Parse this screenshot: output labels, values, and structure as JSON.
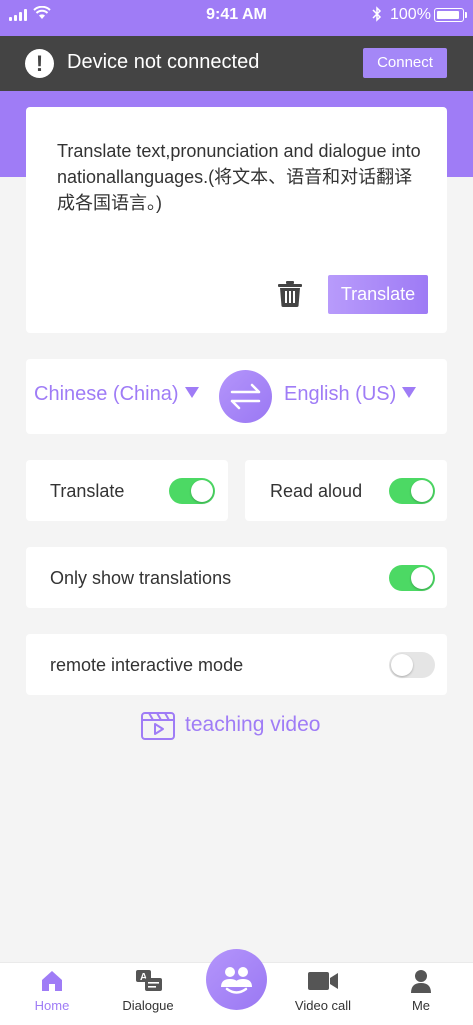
{
  "status_bar": {
    "time": "9:41 AM",
    "battery": "100%"
  },
  "alert": {
    "message": "Device not connected",
    "connect_label": "Connect",
    "icon": "exclamation-icon"
  },
  "input": {
    "text": "Translate text,pronunciation and dialogue into nationallanguages.(将文本、语音和对话翻译成各国语言。)",
    "translate_label": "Translate",
    "icon": "trash-icon"
  },
  "languages": {
    "source": "Chinese (China)",
    "target": "English (US)",
    "swap_icon": "swap-arrows-icon"
  },
  "toggles": {
    "translate": {
      "label": "Translate",
      "on": true
    },
    "read_aloud": {
      "label": "Read aloud",
      "on": true
    },
    "only_show": {
      "label": "Only show translations",
      "on": true
    },
    "remote": {
      "label": "remote interactive mode",
      "on": false
    }
  },
  "teaching_video": {
    "label": "teaching video",
    "icon": "video-clapper-icon"
  },
  "tabs": [
    {
      "label": "Home",
      "icon": "home-icon",
      "active": true
    },
    {
      "label": "Dialogue",
      "icon": "dialogue-icon",
      "active": false
    },
    {
      "label": "",
      "icon": "people-icon",
      "active": false
    },
    {
      "label": "Video call",
      "icon": "video-camera-icon",
      "active": false
    },
    {
      "label": "Me",
      "icon": "person-icon",
      "active": false
    }
  ],
  "colors": {
    "accent": "#9f7cf6",
    "toggle_on": "#4cd964",
    "alert_bg": "#444444"
  }
}
